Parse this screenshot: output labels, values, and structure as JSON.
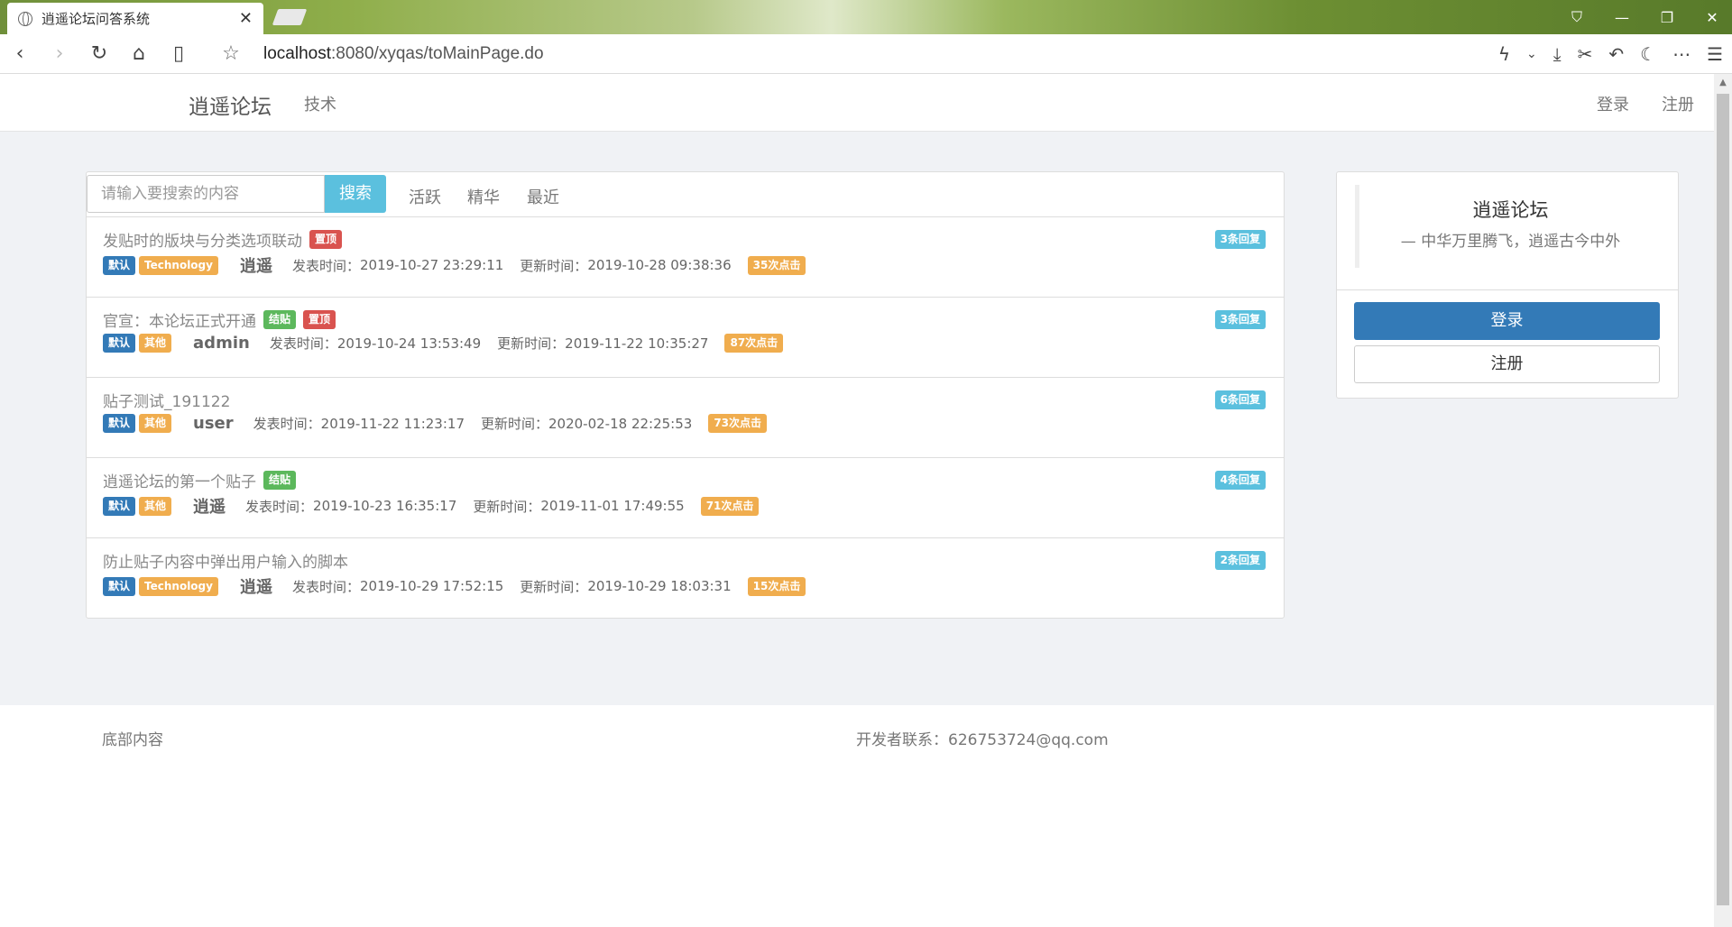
{
  "browser": {
    "tab_title": "逍遥论坛问答系统",
    "url_host": "localhost",
    "url_rest": ":8080/xyqas/toMainPage.do"
  },
  "navbar": {
    "brand": "逍遥论坛",
    "tech": "技术",
    "login": "登录",
    "register": "注册"
  },
  "search": {
    "placeholder": "请输入要搜索的内容",
    "button": "搜索",
    "filters": [
      "活跃",
      "精华",
      "最近"
    ]
  },
  "labels": {
    "published": "发表时间：",
    "updated": "更新时间："
  },
  "posts": [
    {
      "title": "发贴时的版块与分类选项联动",
      "flags": [
        {
          "text": "置顶",
          "color": "#d9534f"
        }
      ],
      "board": "默认",
      "category": "Technology",
      "author": "逍遥",
      "published": "2019-10-27 23:29:11",
      "updated": "2019-10-28 09:38:36",
      "clicks": "35次点击",
      "replies": "3条回复"
    },
    {
      "title": "官宣：本论坛正式开通",
      "flags": [
        {
          "text": "结贴",
          "color": "#5cb85c"
        },
        {
          "text": "置顶",
          "color": "#d9534f"
        }
      ],
      "board": "默认",
      "category": "其他",
      "author": "admin",
      "published": "2019-10-24 13:53:49",
      "updated": "2019-11-22 10:35:27",
      "clicks": "87次点击",
      "replies": "3条回复"
    },
    {
      "title": "贴子测试_191122",
      "flags": [],
      "board": "默认",
      "category": "其他",
      "author": "user",
      "published": "2019-11-22 11:23:17",
      "updated": "2020-02-18 22:25:53",
      "clicks": "73次点击",
      "replies": "6条回复"
    },
    {
      "title": "逍遥论坛的第一个贴子",
      "flags": [
        {
          "text": "结贴",
          "color": "#5cb85c"
        }
      ],
      "board": "默认",
      "category": "其他",
      "author": "逍遥",
      "published": "2019-10-23 16:35:17",
      "updated": "2019-11-01 17:49:55",
      "clicks": "71次点击",
      "replies": "4条回复"
    },
    {
      "title": "防止贴子内容中弹出用户输入的脚本",
      "flags": [],
      "board": "默认",
      "category": "Technology",
      "author": "逍遥",
      "published": "2019-10-29 17:52:15",
      "updated": "2019-10-29 18:03:31",
      "clicks": "15次点击",
      "replies": "2条回复"
    }
  ],
  "sidebar": {
    "name": "逍遥论坛",
    "motto": "— 中华万里腾飞，逍遥古今中外",
    "login": "登录",
    "register": "注册"
  },
  "footer": {
    "left": "底部内容",
    "right": "开发者联系：626753724@qq.com"
  }
}
